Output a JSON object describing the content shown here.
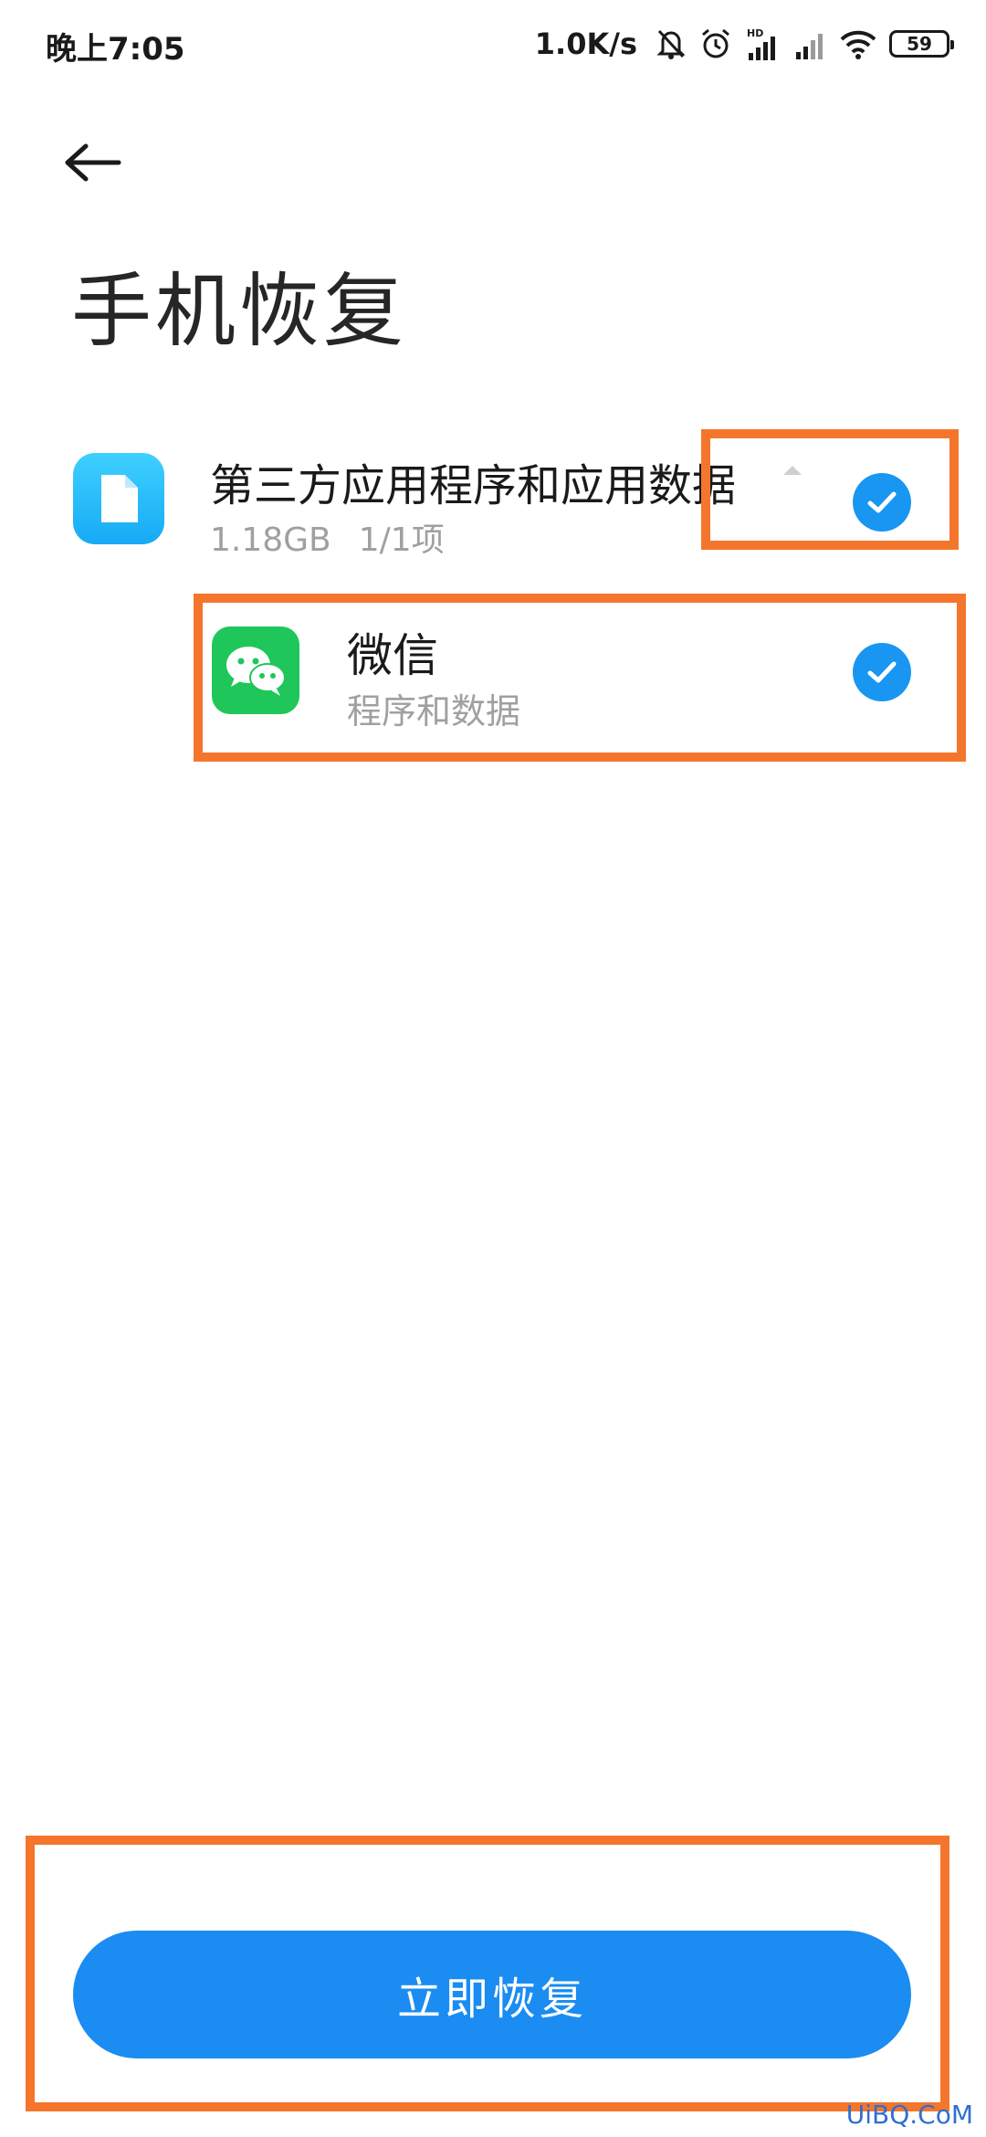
{
  "status_bar": {
    "time": "晚上7:05",
    "network_speed": "1.0K/s",
    "battery_level": "59",
    "icons": [
      "mute-bell-icon",
      "alarm-icon",
      "hd-signal-icon",
      "signal-icon",
      "wifi-icon",
      "battery-icon"
    ]
  },
  "header": {
    "back_icon": "back-arrow-icon",
    "title": "手机恢复"
  },
  "group": {
    "title": "第三方应用程序和应用数据",
    "size": "1.18GB",
    "count": "1/1项",
    "checked": true,
    "icon": "file-icon"
  },
  "apps": [
    {
      "name": "微信",
      "subtitle": "程序和数据",
      "checked": true,
      "icon": "wechat-icon"
    }
  ],
  "actions": {
    "restore_label": "立即恢复"
  },
  "colors": {
    "accent": "#1a8cf2",
    "check": "#1996f2",
    "highlight": "#f4762c",
    "wechat": "#1fc65a"
  },
  "watermark": "UiBQ.CoM"
}
